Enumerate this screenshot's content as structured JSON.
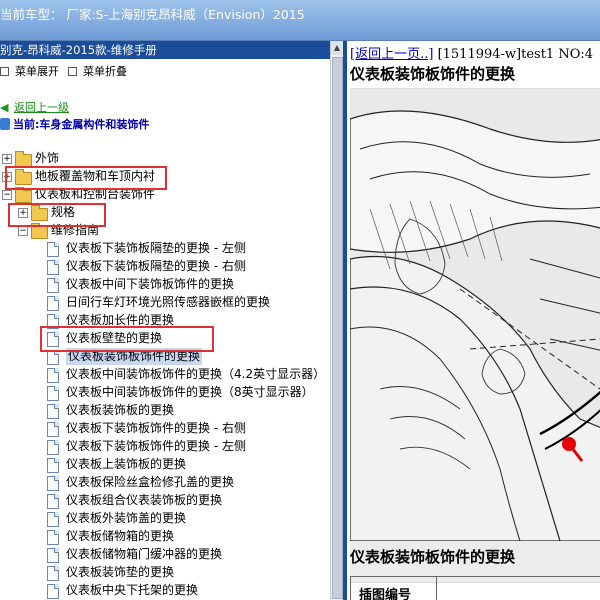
{
  "topbar": {
    "title": "当前车型： 厂家:S-上海别克昂科威（Envision）2015"
  },
  "left": {
    "header": "别克-昂科威-2015款-维修手册",
    "toolbar": {
      "expand": "菜单展开",
      "collapse": "菜单折叠"
    },
    "back_link": "返回上一级",
    "current": "当前:车身金属构件和装饰件",
    "tree": [
      {
        "label": "外饰",
        "type": "folder",
        "expand": "+"
      },
      {
        "label": "地板覆盖物和车顶内衬",
        "type": "folder",
        "expand": "+"
      },
      {
        "label": "仪表板和控制台装饰件",
        "type": "folder",
        "expand": "−"
      },
      {
        "label": "规格",
        "type": "folder",
        "expand": "+"
      },
      {
        "label": "维修指南",
        "type": "folder",
        "expand": "−"
      },
      {
        "label": "仪表板下装饰板隔垫的更换 - 左侧",
        "type": "doc"
      },
      {
        "label": "仪表板下装饰板隔垫的更换 - 右侧",
        "type": "doc"
      },
      {
        "label": "仪表板中间下装饰板饰件的更换",
        "type": "doc"
      },
      {
        "label": "日间行车灯环境光照传感器嵌框的更换",
        "type": "doc"
      },
      {
        "label": "仪表板加长件的更换",
        "type": "doc"
      },
      {
        "label": "仪表板壁垫的更换",
        "type": "doc"
      },
      {
        "label": "仪表板装饰板饰件的更换",
        "type": "doc",
        "selected": true
      },
      {
        "label": "仪表板中间装饰板饰件的更换（4.2英寸显示器）",
        "type": "doc"
      },
      {
        "label": "仪表板中间装饰板饰件的更换（8英寸显示器）",
        "type": "doc"
      },
      {
        "label": "仪表板装饰板的更换",
        "type": "doc"
      },
      {
        "label": "仪表板下装饰板饰件的更换 - 右侧",
        "type": "doc"
      },
      {
        "label": "仪表板下装饰板饰件的更换 - 左侧",
        "type": "doc"
      },
      {
        "label": "仪表板上装饰板的更换",
        "type": "doc"
      },
      {
        "label": "仪表板保险丝盒检修孔盖的更换",
        "type": "doc"
      },
      {
        "label": "仪表板组合仪表装饰板的更换",
        "type": "doc"
      },
      {
        "label": "仪表板外装饰盖的更换",
        "type": "doc"
      },
      {
        "label": "仪表板储物箱的更换",
        "type": "doc"
      },
      {
        "label": "仪表板储物箱门缓冲器的更换",
        "type": "doc"
      },
      {
        "label": "仪表板装饰垫的更换",
        "type": "doc"
      },
      {
        "label": "仪表板中央下托架的更换",
        "type": "doc"
      },
      {
        "label": "仪表板架的更换",
        "type": "doc"
      }
    ]
  },
  "right": {
    "back_link": "[返回上一页..]",
    "doc_id": "[1511994-w]test1 NO:4",
    "title": "仪表板装饰板饰件的更换",
    "section_title": "仪表板装饰板饰件的更换",
    "table_header": "插图编号"
  },
  "colors": {
    "highlight_box": "#e03030",
    "header_blue": "#1c4d9a",
    "marker_red": "#e60000"
  }
}
